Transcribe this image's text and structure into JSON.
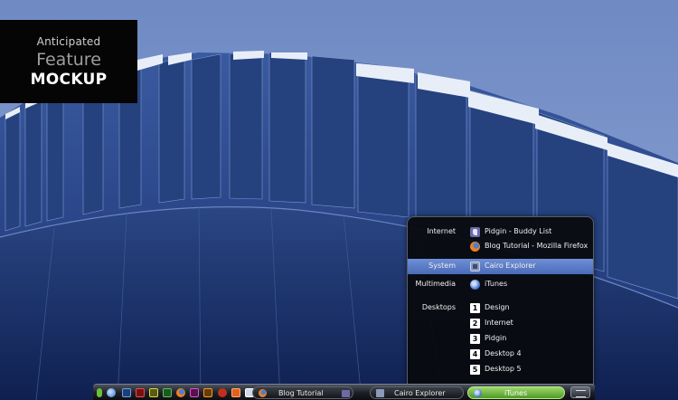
{
  "badge": {
    "line1": "Anticipated",
    "line2": "Feature",
    "line3": "MOCKUP"
  },
  "menu": {
    "categories": {
      "internet": "Internet",
      "system": "System",
      "multimedia": "Multimedia",
      "desktops": "Desktops"
    },
    "items": {
      "pidgin": "Pidgin - Buddy List",
      "firefox": "Blog Tutorial - Mozilla Firefox",
      "cairo": "Cairo Explorer",
      "itunes": "iTunes",
      "desktop1": "Design",
      "desktop2": "Internet",
      "desktop3": "Pidgin",
      "desktop4": "Desktop 4",
      "desktop5": "Desktop 5"
    },
    "desktop_numbers": [
      "1",
      "2",
      "3",
      "4",
      "5"
    ]
  },
  "taskbar": {
    "tasks": [
      "Blog Tutorial",
      "Cairo Explorer",
      "iTunes"
    ],
    "launcher_icons": [
      "leaf-icon",
      "globe-icon",
      "photoshop-icon",
      "flash-icon",
      "fireworks-icon",
      "dreamweaver-icon",
      "firefox-icon",
      "indesign-icon",
      "illustrator-icon",
      "bug-icon",
      "office-icon",
      "monitor-icon"
    ]
  },
  "colors": {
    "wallpaper": "#2a4a8e",
    "selection": "#5a7cc8",
    "active_task": "#6db83c"
  }
}
